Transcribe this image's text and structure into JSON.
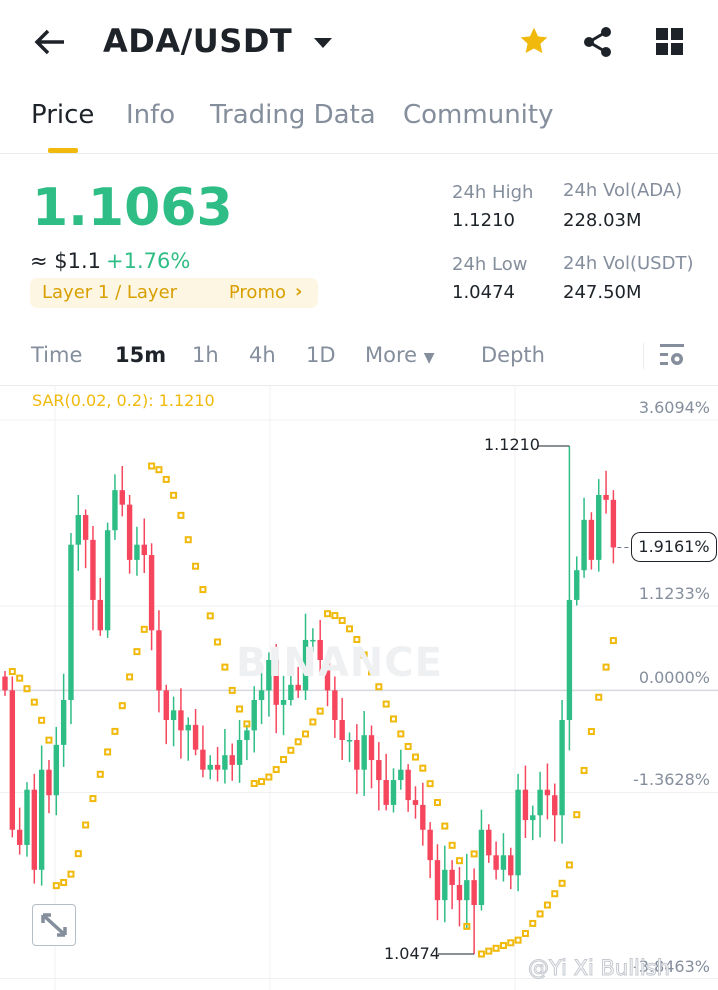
{
  "header": {
    "title": "ADA/USDT"
  },
  "tabs": [
    "Price",
    "Info",
    "Trading Data",
    "Community"
  ],
  "ticker": {
    "price": "1.1063",
    "approx": "≈ $1.1",
    "change": "+1.76%",
    "tag": "Layer 1 / Layer",
    "promo": "Promo",
    "stats": {
      "high_label": "24h High",
      "high": "1.1210",
      "low_label": "24h Low",
      "low": "1.0474",
      "vol_base_label": "24h Vol(ADA)",
      "vol_base": "228.03M",
      "vol_quote_label": "24h Vol(USDT)",
      "vol_quote": "247.50M"
    }
  },
  "intervals": {
    "time": "Time",
    "m15": "15m",
    "h1": "1h",
    "h4": "4h",
    "d1": "1D",
    "more": "More",
    "depth": "Depth"
  },
  "chart": {
    "indicator": "SAR(0.02, 0.2): 1.1210",
    "watermark": "BINANCE",
    "credit": "@Yi Xi Bullish",
    "high_label": "1.1210",
    "low_label": "1.0474",
    "current_pct": "1.9161%"
  },
  "colors": {
    "up": "#2ebd85",
    "down": "#f6465d",
    "sar": "#f0b90b",
    "accent": "#f0b90b"
  },
  "chart_data": {
    "type": "candlestick",
    "base_price": 1.0856,
    "axis_pct": [
      {
        "label": "3.6094%",
        "v": 3.6094
      },
      {
        "label": "1.1233%",
        "v": 1.1233
      },
      {
        "label": "0.0000%",
        "v": 0
      },
      {
        "label": "-1.3628%",
        "v": -1.3628
      },
      {
        "label": "-3.8463%",
        "v": -3.8463
      }
    ],
    "high": {
      "index": 77,
      "value": 1.121
    },
    "low": {
      "index": 64,
      "value": 1.0474
    },
    "current": 1.1063,
    "closes": [
      1.0856,
      1.0654,
      1.0632,
      1.0712,
      1.0596,
      1.0741,
      1.0704,
      1.0777,
      1.0842,
      1.1067,
      1.111,
      1.1074,
      1.0987,
      1.0943,
      1.1088,
      1.1146,
      1.1125,
      1.1045,
      1.1067,
      1.1052,
      1.0943,
      1.0856,
      1.0813,
      1.0827,
      1.0798,
      1.0806,
      1.077,
      1.0741,
      1.0748,
      1.0741,
      1.0762,
      1.0748,
      1.0784,
      1.0798,
      1.0842,
      1.0856,
      1.09,
      1.0835,
      1.0842,
      1.0864,
      1.0856,
      1.0929,
      1.0929,
      1.09,
      1.0856,
      1.0813,
      1.0784,
      1.0784,
      1.0741,
      1.0791,
      1.0755,
      1.0726,
      1.069,
      1.0726,
      1.0741,
      1.0697,
      1.069,
      1.0654,
      1.061,
      1.0552,
      1.0596,
      1.0574,
      1.0552,
      1.0581,
      1.0545,
      1.0654,
      1.0617,
      1.0596,
      1.0617,
      1.0588,
      1.0712,
      1.0668,
      1.0675,
      1.0712,
      1.0704,
      1.0675,
      1.0813,
      1.0987,
      1.103,
      1.1103,
      1.1045,
      1.1139,
      1.1132,
      1.1063
    ]
  }
}
